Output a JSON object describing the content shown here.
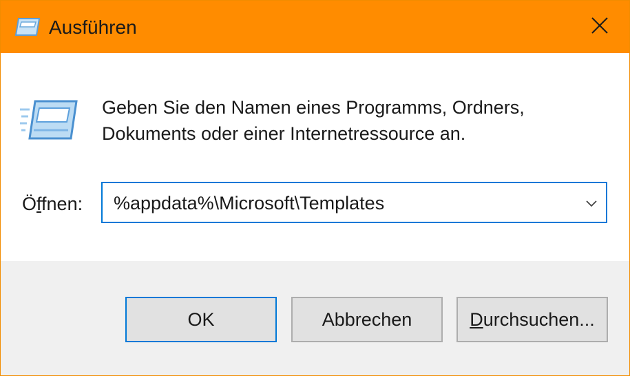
{
  "window": {
    "title": "Ausführen",
    "app_icon": "run-dialog-icon",
    "close_icon": "close-icon"
  },
  "content": {
    "icon": "run-dialog-icon",
    "description_line1": "Geben Sie den Namen eines Programms, Ordners,",
    "description_line2": "Dokuments oder einer Internetressource an.",
    "open_label_prefix": "Ö",
    "open_label_accesskey": "f",
    "open_label_rest": "fnen:",
    "open_value": "%appdata%\\Microsoft\\Templates",
    "dropdown_icon": "chevron-down-icon"
  },
  "buttons": {
    "ok": "OK",
    "cancel": "Abbrechen",
    "browse_accesskey": "D",
    "browse_rest": "urchsuchen..."
  },
  "colors": {
    "titlebar": "#ff8c00",
    "border": "#f28c00",
    "focus_accent": "#0078d7",
    "footer": "#f0f0f0",
    "button_face": "#e1e1e1"
  }
}
